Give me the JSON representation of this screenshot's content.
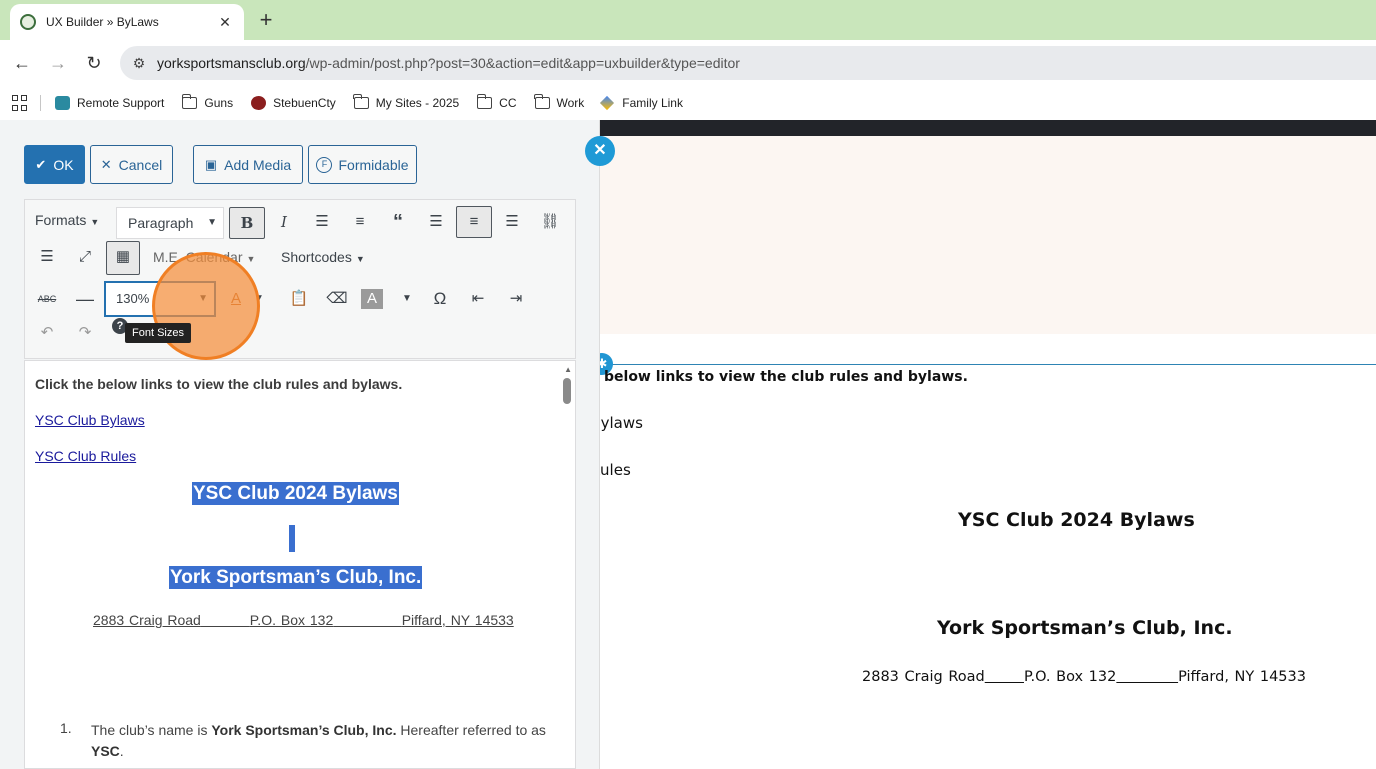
{
  "browser": {
    "tab_title": "UX Builder » ByLaws",
    "tab_close": "✕",
    "new_tab": "+",
    "url_domain": "yorksportsmansclub.org",
    "url_path": "/wp-admin/post.php?post=30&action=edit&app=uxbuilder&type=editor",
    "bookmarks": [
      {
        "label": "Remote Support",
        "icon": "remote-support-icon"
      },
      {
        "label": "Guns",
        "icon": "folder-icon"
      },
      {
        "label": "StebuenCty",
        "icon": "steuben-icon"
      },
      {
        "label": "My Sites - 2025",
        "icon": "folder-icon"
      },
      {
        "label": "CC",
        "icon": "folder-icon"
      },
      {
        "label": "Work",
        "icon": "folder-icon"
      },
      {
        "label": "Family Link",
        "icon": "family-link-icon"
      }
    ]
  },
  "panel": {
    "ok_label": "OK",
    "cancel_label": "Cancel",
    "add_media_label": "Add Media",
    "formidable_label": "Formidable",
    "toolbar": {
      "formats": "Formats",
      "paragraph": "Paragraph",
      "calendar": "M.E. Calendar",
      "shortcodes": "Shortcodes",
      "font_size_value": "130%",
      "tooltip": "Font Sizes"
    },
    "editor": {
      "intro": "Click the below links to view the club rules and bylaws.",
      "link1": "YSC Club Bylaws",
      "link2": "YSC Club Rules",
      "title": "YSC Club 2024 Bylaws",
      "org": "York Sportsman’s Club, Inc.",
      "address_street": "2883 Craig Road",
      "address_box": "P.O. Box 132",
      "address_city": "Piffard, NY 14533",
      "item1_num": "1.",
      "item1_pre": "The club’s name is ",
      "item1_bold": "York Sportsman’s Club, Inc.",
      "item1_mid": "  Hereafter referred to as ",
      "item1_bold2": "YSC",
      "item1_end": "."
    }
  },
  "preview": {
    "intro": "below links to view the club rules and bylaws.",
    "link1": "b Bylaws",
    "link2": "b Rules",
    "title": "YSC Club 2024 Bylaws",
    "org": "York Sportsman’s Club, Inc.",
    "address_street": "2883 Craig Road",
    "address_box": "P.O. Box 132",
    "address_city": "Piffard, NY 14533"
  },
  "colors": {
    "tab_strip": "#c9e6bb",
    "primary": "#2471b0",
    "close_circle": "#1f9ad6",
    "selection": "#3a6fcf",
    "highlight": "#f07f24"
  }
}
